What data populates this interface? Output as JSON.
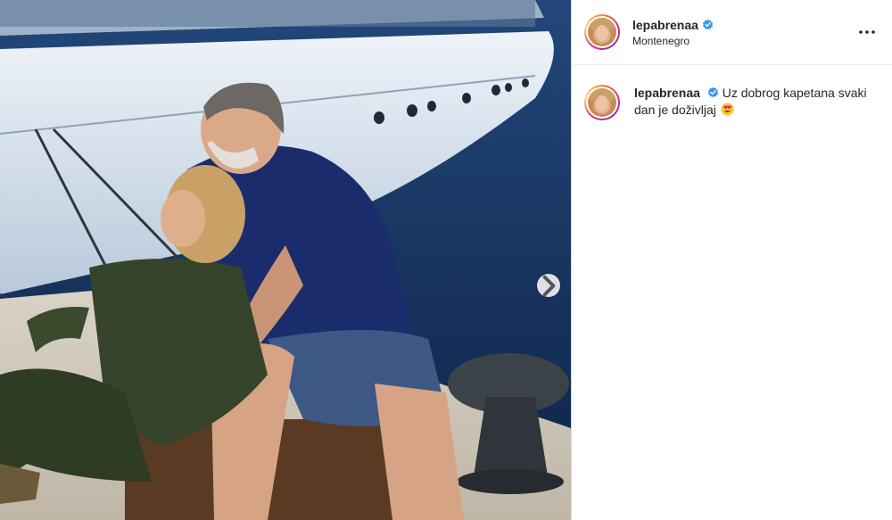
{
  "post": {
    "author": {
      "username": "lepabrenaa",
      "verified": true,
      "location": "Montenegro"
    },
    "caption": {
      "username": "lepabrenaa",
      "text": "Uz dobrog kapetana svaki dan je doživljaj",
      "emoji": "heart-eyes-emoji"
    },
    "media": {
      "description_icon": "photo",
      "next_icon": "chevron-right-icon"
    },
    "header_menu_icon": "more-horizontal-icon",
    "colors": {
      "verified_blue": "#3897f0",
      "text": "#262626",
      "border": "#dbdbdb"
    }
  }
}
